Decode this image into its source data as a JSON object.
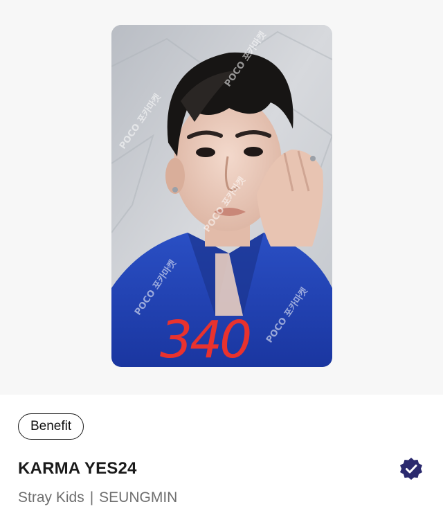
{
  "card": {
    "price_annotation": "340",
    "watermark": "POCO 포카마켓"
  },
  "tag": {
    "label": "Benefit"
  },
  "item": {
    "title": "KARMA YES24",
    "group": "Stray Kids",
    "separator": "|",
    "member": "SEUNGMIN"
  },
  "icons": {
    "verified": "verified-badge-icon"
  },
  "colors": {
    "verified_badge": "#2b2a6e",
    "annotation_red": "#e8322e",
    "jacket_blue": "#1f3fae"
  }
}
